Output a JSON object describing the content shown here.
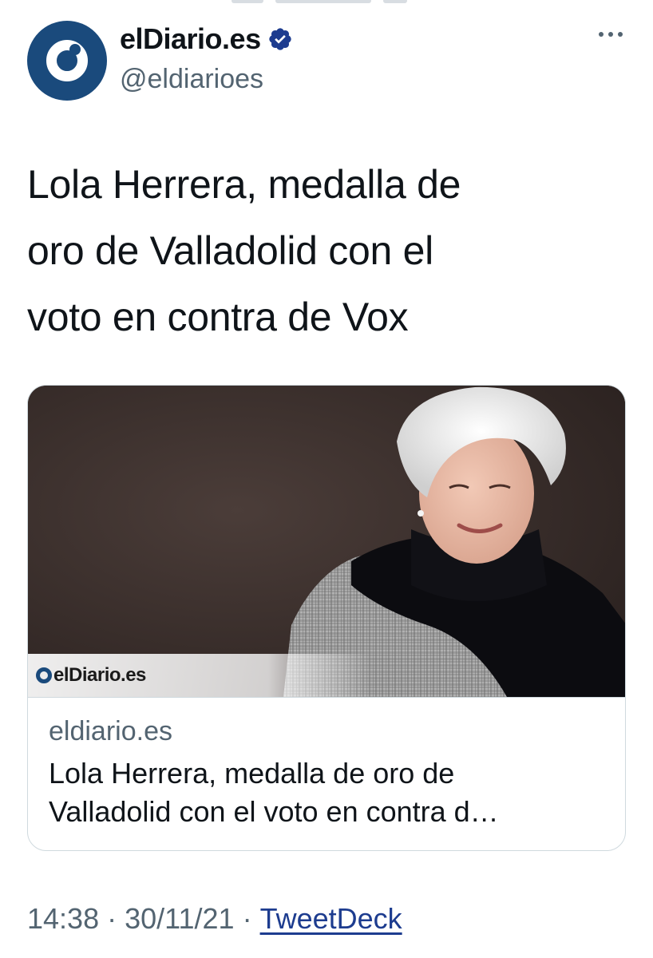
{
  "account": {
    "display_name": "elDiario.es",
    "handle": "@eldiarioes",
    "verified": true,
    "avatar_icon": "eldiario-logo-icon",
    "brand_color": "#1a4a7c"
  },
  "header": {
    "more_icon": "more-options-icon"
  },
  "tweet": {
    "text": "Lola Herrera, medalla de oro de Valladolid con el voto en contra de Vox",
    "lines": [
      "Lola Herrera, medalla de",
      "oro de Valladolid con el",
      "voto en contra de Vox"
    ]
  },
  "link_card": {
    "image_alt": "Portrait of Lola Herrera",
    "watermark_text": "elDiario.es",
    "domain": "eldiario.es",
    "title_lines": [
      "Lola Herrera, medalla de oro de",
      "Valladolid con el voto en contra d…"
    ]
  },
  "meta": {
    "time": "14:38",
    "separator": "·",
    "date": "30/11/21",
    "source": "TweetDeck",
    "link_color": "#1d3c8f"
  }
}
